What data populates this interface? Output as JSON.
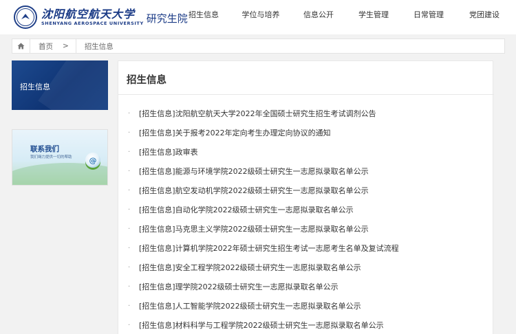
{
  "header": {
    "logo_cn": "沈阳航空航天大学",
    "logo_en": "SHENYANG AEROSPACE UNIVERSITY",
    "logo_sub": "研究生院",
    "nav": [
      "招生信息",
      "学位与培养",
      "信息公开",
      "学生管理",
      "日常管理",
      "党团建设"
    ]
  },
  "breadcrumb": {
    "home": "首页",
    "separator": ">",
    "current": "招生信息"
  },
  "sidebar": {
    "title": "招生信息",
    "contact_title": "联系我们",
    "contact_sub": "我们竭力提供一切的帮助",
    "contact_icon": "@"
  },
  "main": {
    "title": "招生信息",
    "news": [
      "[招生信息]沈阳航空航天大学2022年全国硕士研究生招生考试调剂公告",
      "[招生信息]关于报考2022年定向考生办理定向协议的通知",
      "[招生信息]政审表",
      "[招生信息]能源与环境学院2022级硕士研究生一志愿拟录取名单公示",
      "[招生信息]航空发动机学院2022级硕士研究生一志愿拟录取名单公示",
      "[招生信息]自动化学院2022级硕士研究生一志愿拟录取名单公示",
      "[招生信息]马克思主义学院2022级硕士研究生一志愿拟录取名单公示",
      "[招生信息]计算机学院2022年硕士研究生招生考试一志愿考生名单及复试流程",
      "[招生信息]安全工程学院2022级硕士研究生一志愿拟录取名单公示",
      "[招生信息]理学院2022级硕士研究生一志愿拟录取名单公示",
      "[招生信息]人工智能学院2022级硕士研究生一志愿拟录取名单公示",
      "[招生信息]材料科学与工程学院2022级硕士研究生一志愿拟录取名单公示"
    ]
  },
  "colors": {
    "brand": "#1a3a86",
    "sidebar_bg": "#123c80"
  },
  "icons": {
    "home": "home-icon",
    "seal": "university-seal-icon"
  }
}
